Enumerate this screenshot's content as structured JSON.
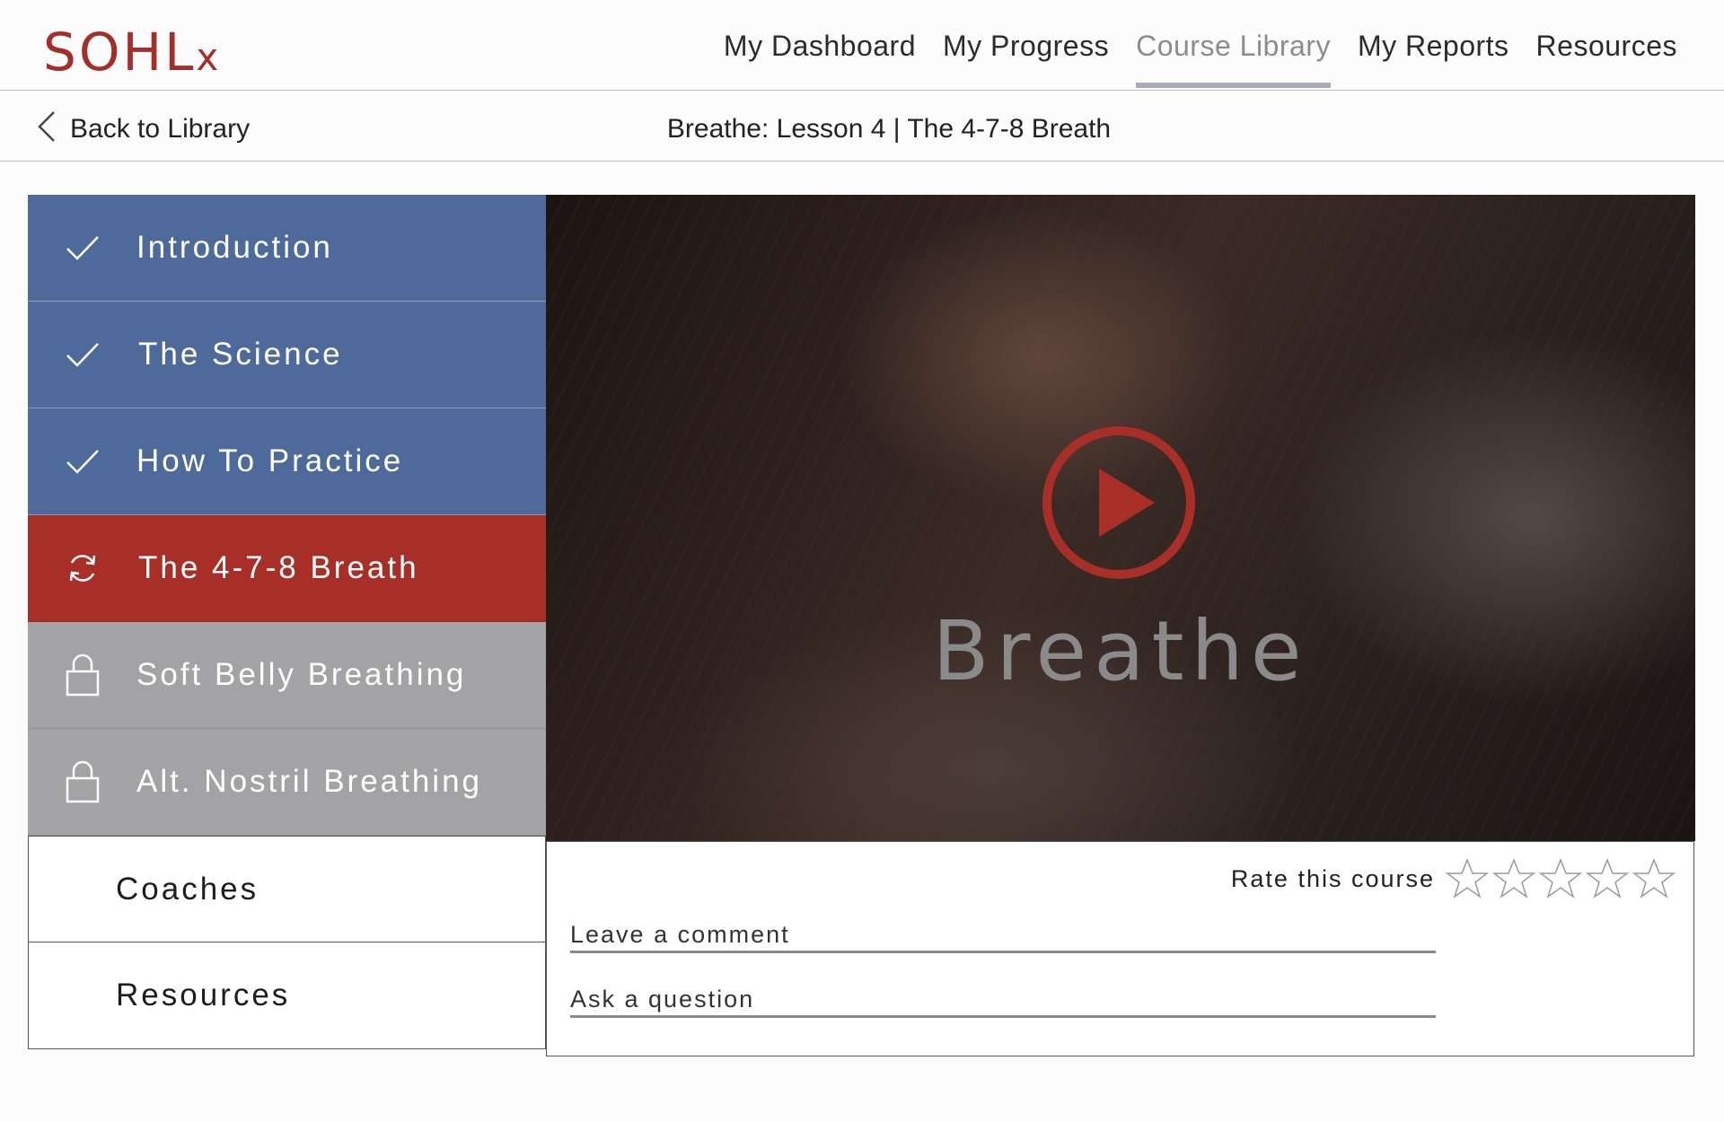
{
  "brand": {
    "logo_main": "SOHL",
    "logo_suffix": "x",
    "accent": "#a52e2a"
  },
  "nav": {
    "items": [
      {
        "label": "My Dashboard",
        "active": false
      },
      {
        "label": "My Progress",
        "active": false
      },
      {
        "label": "Course Library",
        "active": true
      },
      {
        "label": "My Reports",
        "active": false
      },
      {
        "label": "Resources",
        "active": false
      }
    ]
  },
  "subbar": {
    "back_label": "Back to Library",
    "lesson_title": "Breathe: Lesson 4 | The 4-7-8 Breath"
  },
  "sidebar": {
    "items": [
      {
        "label": "Introduction",
        "state": "done",
        "icon": "check-icon"
      },
      {
        "label": "The Science",
        "state": "done",
        "icon": "check-icon"
      },
      {
        "label": "How To Practice",
        "state": "done",
        "icon": "check-icon"
      },
      {
        "label": "The 4-7-8 Breath",
        "state": "current",
        "icon": "refresh-icon"
      },
      {
        "label": "Soft Belly Breathing",
        "state": "locked",
        "icon": "lock-icon"
      },
      {
        "label": "Alt. Nostril Breathing",
        "state": "locked",
        "icon": "lock-icon"
      },
      {
        "label": "Coaches",
        "state": "plain"
      },
      {
        "label": "Resources",
        "state": "plain"
      }
    ],
    "colors": {
      "done": "#4e6a9a",
      "current": "#a82e28",
      "locked": "#a3a3a6"
    }
  },
  "video": {
    "title": "Breathe",
    "play_icon": "play-icon"
  },
  "feedback": {
    "rate_label": "Rate this course",
    "rating": 0,
    "max_rating": 5,
    "comment_placeholder": "Leave a comment",
    "question_placeholder": "Ask a question"
  }
}
